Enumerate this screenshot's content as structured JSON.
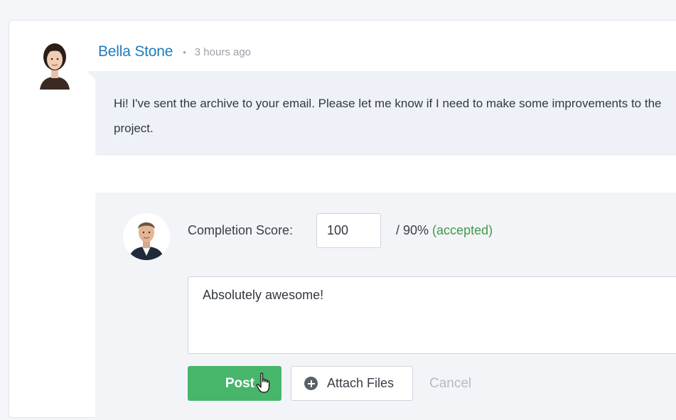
{
  "comment": {
    "author": "Bella Stone",
    "separator": "•",
    "time": "3 hours ago",
    "message": "Hi! I've sent the archive to your email. Please let me know if I need to make some improvements to the project."
  },
  "reply": {
    "score_label": "Completion Score:",
    "score_value": "100",
    "score_threshold": "/ 90%",
    "score_status": "(accepted)",
    "comment_text": "Absolutely awesome!",
    "post_label": "Post",
    "attach_label": "Attach Files",
    "cancel_label": "Cancel"
  },
  "colors": {
    "author_name": "#1f7bbd",
    "accepted": "#3f9a4a",
    "post_button": "#47b66b",
    "bubble_bg": "#eef1f7"
  },
  "icons": {
    "attach": "plus-circle-icon",
    "cursor": "hand-pointer-icon"
  }
}
